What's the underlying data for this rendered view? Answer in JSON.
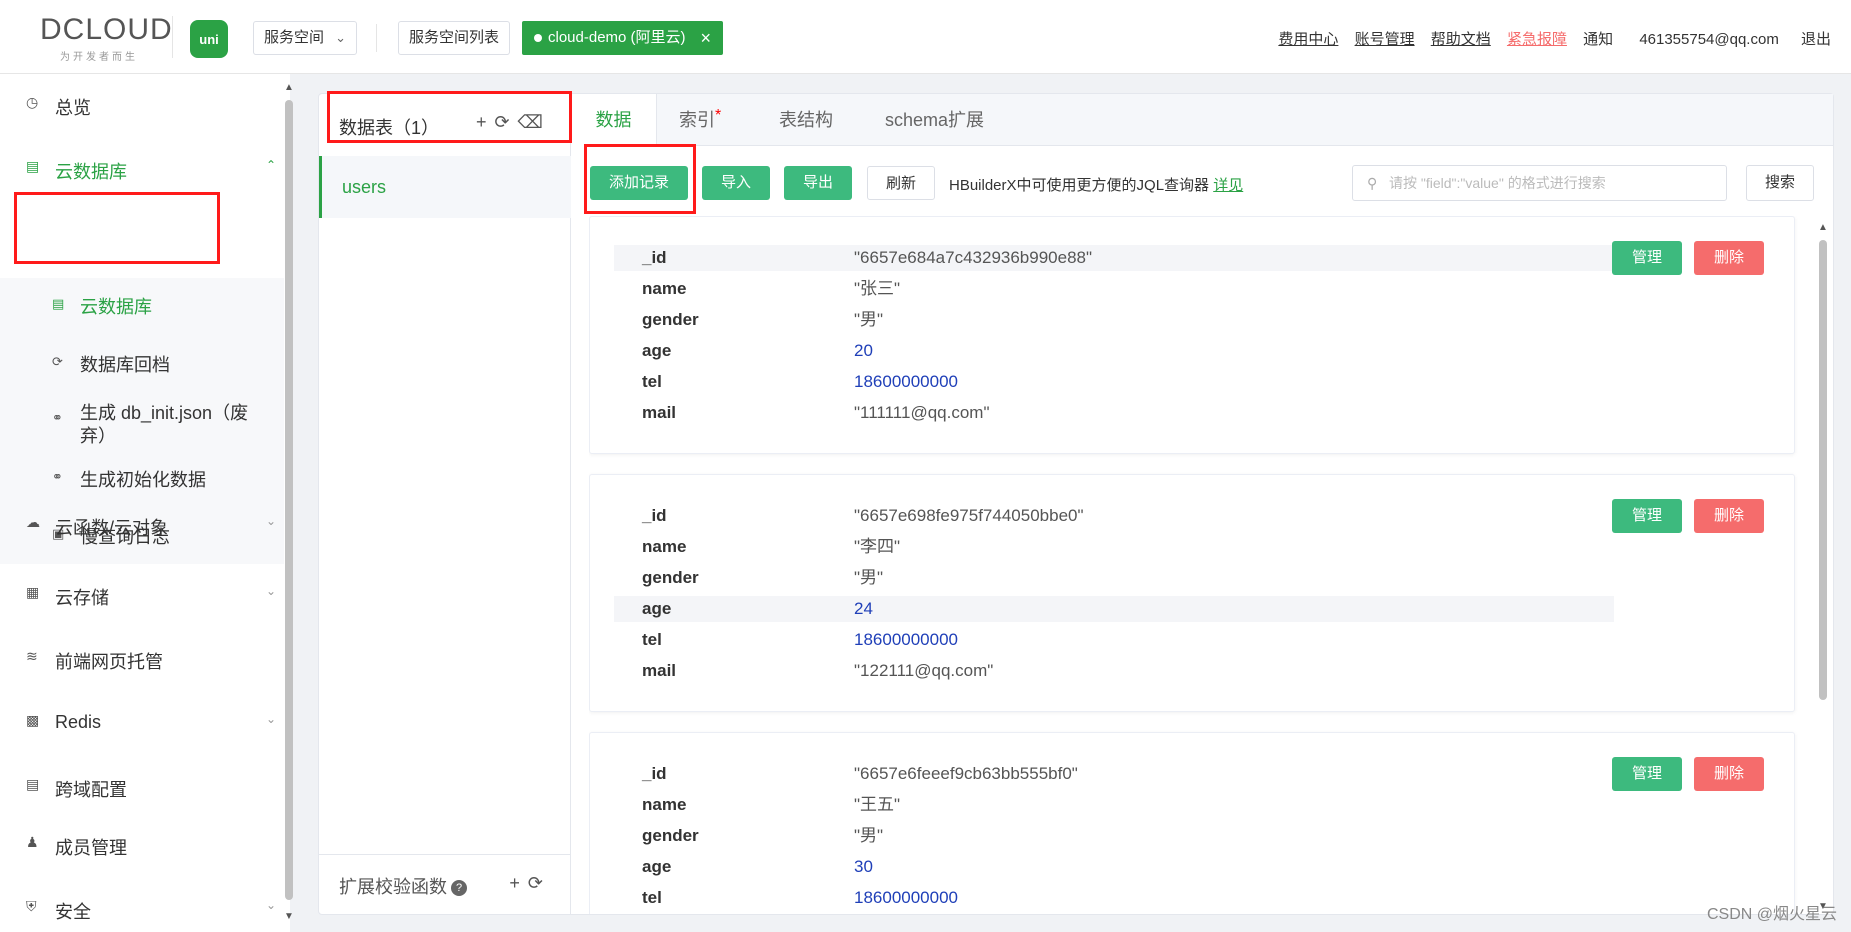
{
  "header": {
    "logo_text": "DCLOUD",
    "logo_sub": "为开发者而生",
    "uni_icon": "uni",
    "space_select": "服务空间",
    "space_list_btn": "服务空间列表",
    "current_space": "cloud-demo (阿里云)",
    "links": {
      "billing": "费用中心",
      "account": "账号管理",
      "help": "帮助文档",
      "emergency": "紧急报障",
      "notify": "通知",
      "email": "461355754@qq.com",
      "logout": "退出"
    }
  },
  "sidebar": {
    "overview": "总览",
    "clouddb": "云数据库",
    "sub": {
      "clouddb": "云数据库",
      "rollback": "数据库回档",
      "db_init": "生成 db_init.json（废弃）",
      "init_data": "生成初始化数据",
      "slow_log": "慢查询日志"
    },
    "functions": "云函数/云对象",
    "storage": "云存储",
    "hosting": "前端网页托管",
    "redis": "Redis",
    "cors": "跨域配置",
    "members": "成员管理",
    "security": "安全"
  },
  "tables": {
    "title": "数据表（1）",
    "items": [
      "users"
    ],
    "ext_label": "扩展校验函数"
  },
  "tabs": [
    "数据",
    "索引",
    "表结构",
    "schema扩展"
  ],
  "toolbar": {
    "add": "添加记录",
    "import": "导入",
    "export": "导出",
    "refresh": "刷新",
    "hint": "HBuilderX中可使用更方便的JQL查询器 ",
    "hint_link": "详见",
    "search_placeholder": "请按 \"field\":\"value\" 的格式进行搜索",
    "search_btn": "搜索"
  },
  "record_actions": {
    "manage": "管理",
    "delete": "删除"
  },
  "records": [
    {
      "_id": "\"6657e684a7c432936b990e88\"",
      "name": "\"张三\"",
      "gender": "\"男\"",
      "age": "20",
      "tel": "18600000000",
      "mail": "\"111111@qq.com\""
    },
    {
      "_id": "\"6657e698fe975f744050bbe0\"",
      "name": "\"李四\"",
      "gender": "\"男\"",
      "age": "24",
      "tel": "18600000000",
      "mail": "\"122111@qq.com\""
    },
    {
      "_id": "\"6657e6feeef9cb63bb555bf0\"",
      "name": "\"王五\"",
      "gender": "\"男\"",
      "age": "30",
      "tel": "18600000000"
    }
  ],
  "field_keys": {
    "id": "_id",
    "name": "name",
    "gender": "gender",
    "age": "age",
    "tel": "tel",
    "mail": "mail"
  },
  "watermark": "CSDN @烟火星云",
  "colors": {
    "accent": "#2ba245",
    "danger": "#f56c6c",
    "annotation": "#ff1a1a"
  }
}
